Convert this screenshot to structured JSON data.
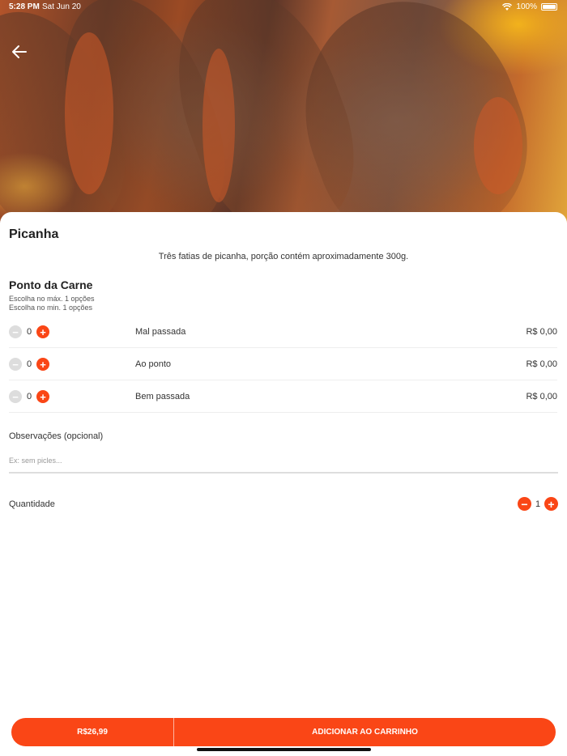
{
  "status_bar": {
    "time": "5:28 PM",
    "date": "Sat Jun 20",
    "battery_percent": "100%",
    "icons": [
      "wifi-icon",
      "battery-icon"
    ]
  },
  "navigation": {
    "back_icon": "arrow-left-icon"
  },
  "product": {
    "title": "Picanha",
    "description": "Três fatias de picanha, porção contém aproximadamente 300g."
  },
  "option_group": {
    "title": "Ponto da Carne",
    "max_rule": "Escolha no máx. 1 opções",
    "min_rule": "Escolha no min. 1 opções",
    "options": [
      {
        "name": "Mal passada",
        "count": "0",
        "price": "R$ 0,00"
      },
      {
        "name": "Ao ponto",
        "count": "0",
        "price": "R$ 0,00"
      },
      {
        "name": "Bem passada",
        "count": "0",
        "price": "R$ 0,00"
      }
    ]
  },
  "notes": {
    "label": "Observações (opcional)",
    "placeholder": "Ex: sem picles...",
    "value": ""
  },
  "quantity": {
    "label": "Quantidade",
    "value": "1"
  },
  "bottom_bar": {
    "price": "R$26,99",
    "add_label": "ADICIONAR AO CARRINHO"
  },
  "colors": {
    "accent": "#fa4616",
    "disabled": "#dddddd",
    "divider": "#eeeeee"
  }
}
